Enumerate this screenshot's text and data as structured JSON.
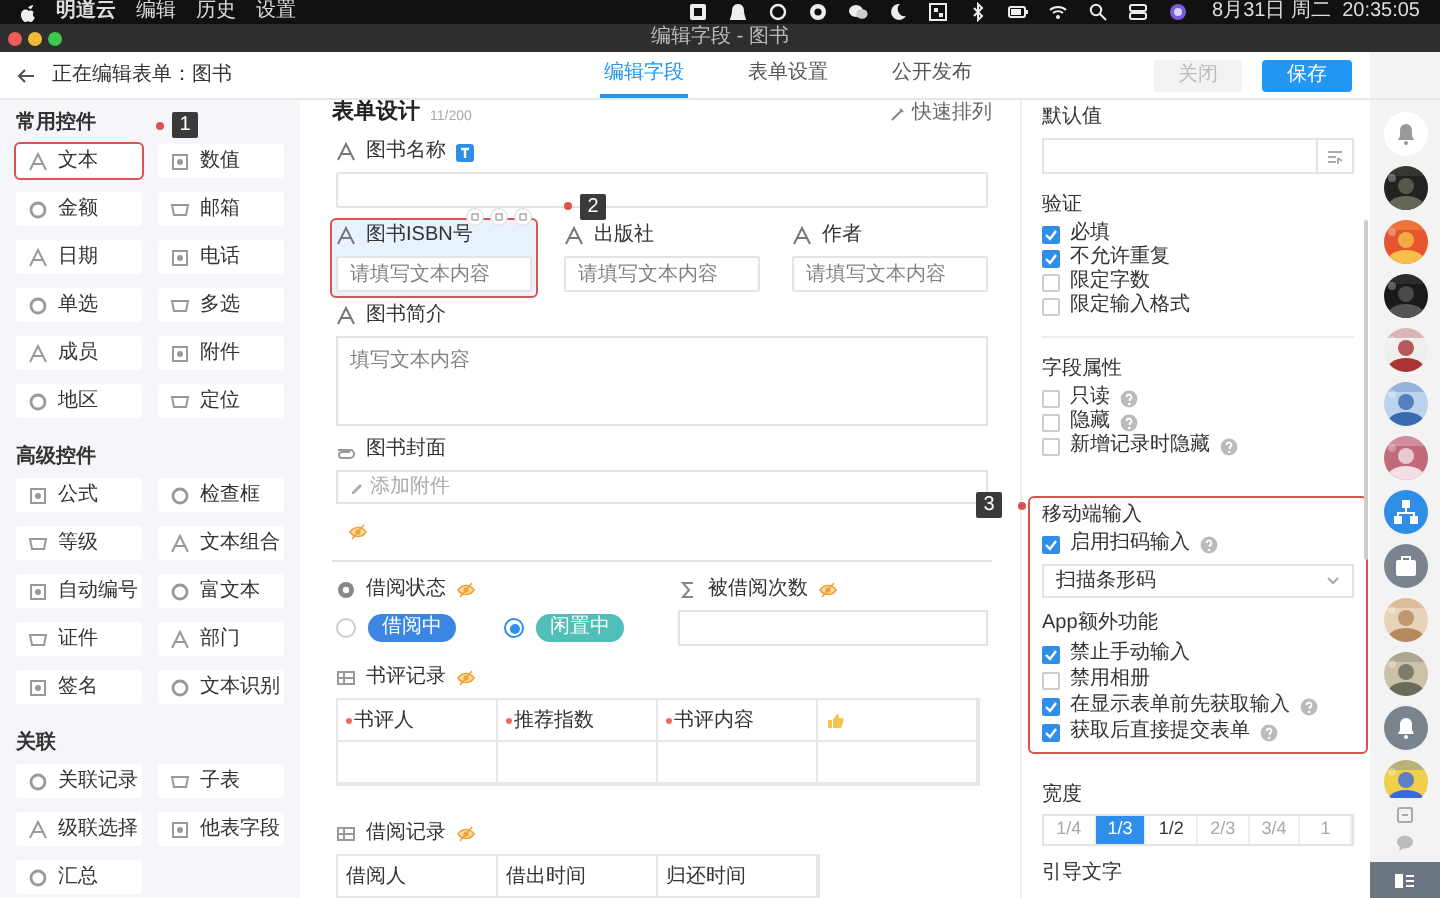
{
  "menubar": {
    "app": "明道云",
    "menus": [
      "编辑",
      "历史",
      "设置"
    ],
    "clock": "8月31日 周二  20:35:05"
  },
  "window": {
    "title": "编辑字段 - 图书"
  },
  "header": {
    "title": "正在编辑表单：图书",
    "tabs": [
      {
        "label": "编辑字段",
        "selected": true
      },
      {
        "label": "表单设置",
        "selected": false
      },
      {
        "label": "公开发布",
        "selected": false
      }
    ],
    "close": "关闭",
    "save": "保存"
  },
  "sidebar": {
    "sections": [
      {
        "title": "常用控件",
        "items": [
          {
            "label": "文本",
            "highlighted": true
          },
          {
            "label": "数值",
            "highlighted": false
          },
          {
            "label": "金额",
            "highlighted": false
          },
          {
            "label": "邮箱",
            "highlighted": false
          },
          {
            "label": "日期",
            "highlighted": false
          },
          {
            "label": "电话",
            "highlighted": false
          },
          {
            "label": "单选",
            "highlighted": false
          },
          {
            "label": "多选",
            "highlighted": false
          },
          {
            "label": "成员",
            "highlighted": false
          },
          {
            "label": "附件",
            "highlighted": false
          },
          {
            "label": "地区",
            "highlighted": false
          },
          {
            "label": "定位",
            "highlighted": false
          }
        ]
      },
      {
        "title": "高级控件",
        "items": [
          {
            "label": "公式",
            "highlighted": false
          },
          {
            "label": "检查框",
            "highlighted": false
          },
          {
            "label": "等级",
            "highlighted": false
          },
          {
            "label": "文本组合",
            "highlighted": false
          },
          {
            "label": "自动编号",
            "highlighted": false
          },
          {
            "label": "富文本",
            "highlighted": false
          },
          {
            "label": "证件",
            "highlighted": false
          },
          {
            "label": "部门",
            "highlighted": false
          },
          {
            "label": "签名",
            "highlighted": false
          },
          {
            "label": "文本识别",
            "highlighted": false
          }
        ]
      },
      {
        "title": "关联",
        "items": [
          {
            "label": "关联记录",
            "highlighted": false
          },
          {
            "label": "子表",
            "highlighted": false
          },
          {
            "label": "级联选择",
            "highlighted": false
          },
          {
            "label": "他表字段",
            "highlighted": false
          },
          {
            "label": "汇总",
            "highlighted": false
          }
        ]
      }
    ]
  },
  "form": {
    "title": "表单设计",
    "count": "11/200",
    "quick_sort": "快速排列",
    "rows": [
      [
        {
          "kind": "text",
          "label": "图书名称",
          "title_field": true,
          "hidden": false,
          "selected": false,
          "highlighted": false
        }
      ],
      [
        {
          "kind": "text",
          "label": "图书ISBN号",
          "placeholder": "请填写文本内容",
          "title_field": false,
          "hidden": false,
          "selected": true,
          "highlighted": true
        },
        {
          "kind": "text",
          "label": "出版社",
          "placeholder": "请填写文本内容",
          "title_field": false,
          "hidden": false,
          "selected": false,
          "highlighted": false
        },
        {
          "kind": "text",
          "label": "作者",
          "placeholder": "请填写文本内容",
          "title_field": false,
          "hidden": false,
          "selected": false,
          "highlighted": false
        }
      ],
      [
        {
          "kind": "textarea",
          "label": "图书简介",
          "placeholder": "填写文本内容",
          "title_field": false,
          "hidden": false,
          "selected": false,
          "highlighted": false
        }
      ],
      [
        {
          "kind": "attachment",
          "label": "图书封面",
          "button": "添加附件",
          "title_field": false,
          "hidden": false,
          "selected": false,
          "highlighted": false
        }
      ],
      [
        {
          "kind": "marker",
          "title_field": false,
          "hidden": true,
          "selected": false,
          "highlighted": false
        }
      ],
      [
        {
          "kind": "divider"
        }
      ],
      [
        {
          "kind": "radio",
          "label": "借阅状态",
          "title_field": false,
          "hidden": true,
          "selected": false,
          "highlighted": false,
          "options": [
            {
              "label": "借阅中",
              "selected": false,
              "color": "#3b86e0"
            },
            {
              "label": "闲置中",
              "selected": true,
              "color": "#4fbfb7"
            }
          ]
        },
        {
          "kind": "number",
          "label": "被借阅次数",
          "title_field": false,
          "hidden": true,
          "selected": false,
          "highlighted": false
        }
      ],
      [
        {
          "kind": "table",
          "label": "书评记录",
          "title_field": false,
          "hidden": true,
          "selected": false,
          "highlighted": false,
          "columns": [
            {
              "kind": "text",
              "label": "书评人",
              "required": true
            },
            {
              "kind": "text",
              "label": "推荐指数",
              "required": true
            },
            {
              "kind": "text",
              "label": "书评内容",
              "required": true
            },
            {
              "kind": "icon",
              "required": false
            }
          ]
        }
      ],
      [
        {
          "kind": "table",
          "label": "借阅记录",
          "title_field": false,
          "hidden": true,
          "selected": false,
          "highlighted": false,
          "columns": [
            {
              "kind": "text",
              "label": "借阅人",
              "required": false
            },
            {
              "kind": "text",
              "label": "借出时间",
              "required": false
            },
            {
              "kind": "text",
              "label": "归还时间",
              "required": false
            }
          ]
        }
      ]
    ]
  },
  "properties": {
    "default_value": {
      "title": "默认值"
    },
    "validation": {
      "title": "验证",
      "options": [
        {
          "label": "必填",
          "checked": true,
          "help": false
        },
        {
          "label": "不允许重复",
          "checked": true,
          "help": false
        },
        {
          "label": "限定字数",
          "checked": false,
          "help": false
        },
        {
          "label": "限定输入格式",
          "checked": false,
          "help": false
        }
      ]
    },
    "field_attributes": {
      "title": "字段属性",
      "options": [
        {
          "label": "只读",
          "checked": false,
          "help": true
        },
        {
          "label": "隐藏",
          "checked": false,
          "help": true
        },
        {
          "label": "新增记录时隐藏",
          "checked": false,
          "help": true
        }
      ]
    },
    "mobile_input": {
      "title": "移动端输入",
      "highlighted": true,
      "options": [
        {
          "label": "启用扫码输入",
          "checked": true,
          "help": true
        }
      ],
      "scan_mode": "扫描条形码",
      "app_title": "App额外功能",
      "app_options": [
        {
          "label": "禁止手动输入",
          "checked": true,
          "help": false
        },
        {
          "label": "禁用相册",
          "checked": false,
          "help": false
        },
        {
          "label": "在显示表单前先获取输入",
          "checked": true,
          "help": true
        },
        {
          "label": "获取后直接提交表单",
          "checked": true,
          "help": true
        }
      ]
    },
    "width": {
      "title": "宽度",
      "options": [
        {
          "label": "1/4",
          "selected": false,
          "disabled": true
        },
        {
          "label": "1/3",
          "selected": true,
          "disabled": false
        },
        {
          "label": "1/2",
          "selected": false,
          "disabled": false
        },
        {
          "label": "2/3",
          "selected": false,
          "disabled": true
        },
        {
          "label": "3/4",
          "selected": false,
          "disabled": true
        },
        {
          "label": "1",
          "selected": false,
          "disabled": true
        }
      ]
    },
    "guide_text": {
      "title": "引导文字"
    }
  },
  "contacts": [
    {
      "kind": "bell"
    },
    {
      "kind": "picture"
    },
    {
      "kind": "picture"
    },
    {
      "kind": "picture"
    },
    {
      "kind": "picture"
    },
    {
      "kind": "picture"
    },
    {
      "kind": "picture"
    },
    {
      "kind": "org"
    },
    {
      "kind": "briefcase"
    },
    {
      "kind": "picture"
    },
    {
      "kind": "picture"
    },
    {
      "kind": "bell"
    },
    {
      "kind": "picture"
    }
  ],
  "callouts": [
    {
      "number": "1"
    },
    {
      "number": "2"
    },
    {
      "number": "3"
    }
  ]
}
